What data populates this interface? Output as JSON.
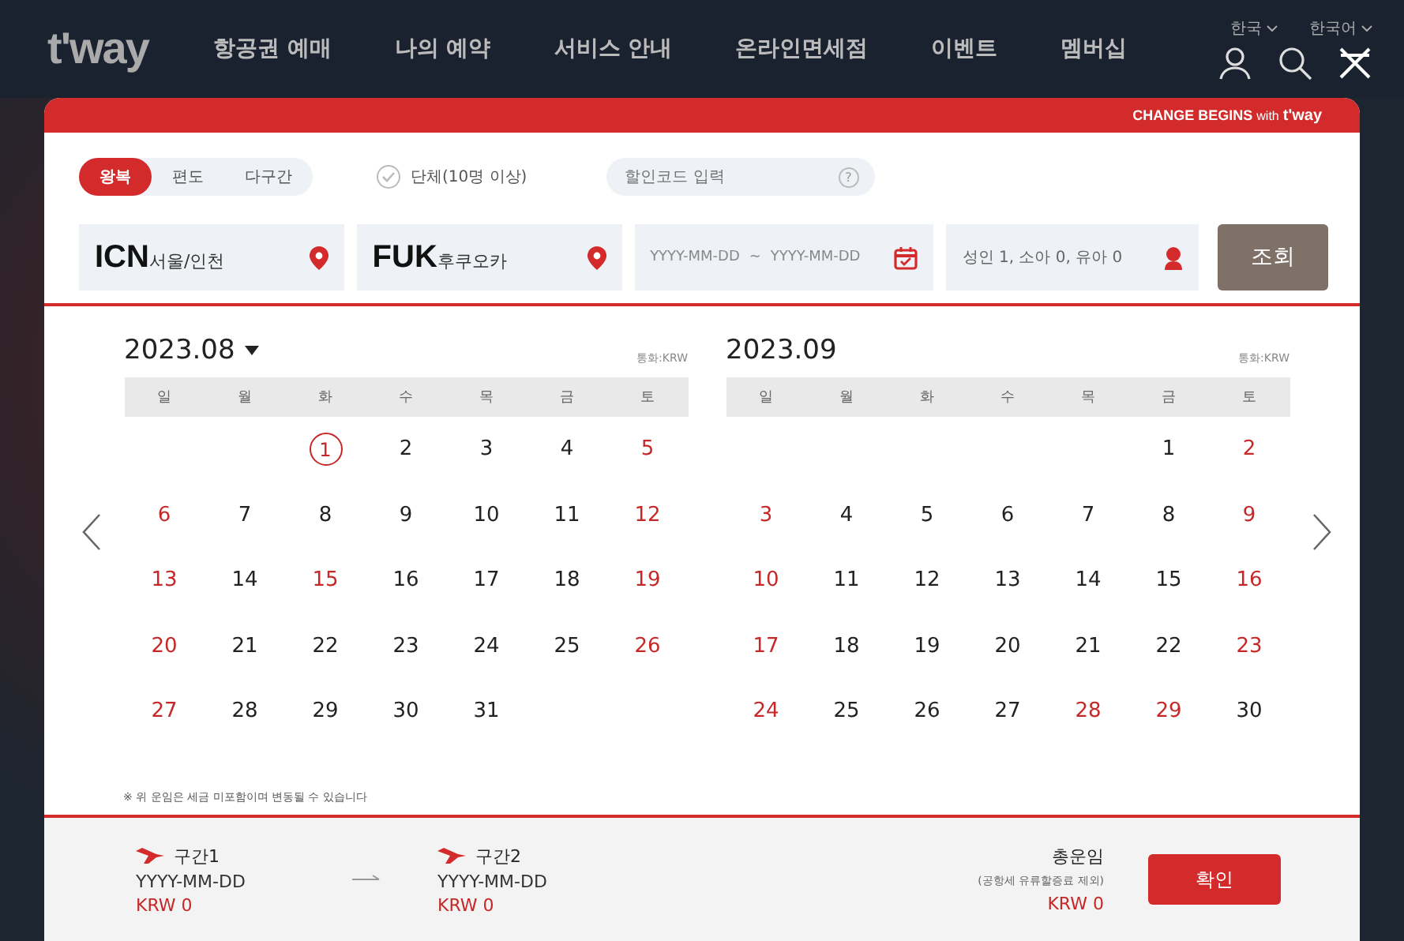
{
  "header": {
    "logo": "t'way",
    "nav": [
      "항공권 예매",
      "나의 예약",
      "서비스 안내",
      "온라인면세점",
      "이벤트",
      "멤버십"
    ],
    "country": "한국",
    "language": "한국어"
  },
  "banner": {
    "slogan": "CHANGE BEGINS",
    "with": "with",
    "brand": "t'way"
  },
  "trip_types": [
    {
      "label": "왕복",
      "selected": true
    },
    {
      "label": "편도",
      "selected": false
    },
    {
      "label": "다구간",
      "selected": false
    }
  ],
  "group": {
    "label": "단체(10명 이상)",
    "checked": false
  },
  "promo": {
    "placeholder": "할인코드 입력",
    "help": "?"
  },
  "origin": {
    "code": "ICN",
    "city": "서울/인천"
  },
  "destination": {
    "code": "FUK",
    "city": "후쿠오카"
  },
  "dates": {
    "from_placeholder": "YYYY-MM-DD",
    "separator": "~",
    "to_placeholder": "YYYY-MM-DD"
  },
  "passengers": {
    "value": "성인 1, 소아 0, 유아 0"
  },
  "search_button": "조회",
  "months": [
    {
      "title": "2023.08",
      "dropdown": true,
      "currency": "통화:KRW",
      "weekdays": [
        "일",
        "월",
        "화",
        "수",
        "목",
        "금",
        "토"
      ],
      "weeks": [
        [
          {
            "kind": "blank"
          },
          {
            "kind": "blank"
          },
          {
            "kind": "date",
            "day": "1",
            "holiday": false,
            "circled": true
          },
          {
            "kind": "date",
            "day": "2",
            "holiday": false,
            "circled": false
          },
          {
            "kind": "date",
            "day": "3",
            "holiday": false,
            "circled": false
          },
          {
            "kind": "date",
            "day": "4",
            "holiday": false,
            "circled": false
          },
          {
            "kind": "date",
            "day": "5",
            "holiday": true,
            "circled": false
          }
        ],
        [
          {
            "kind": "date",
            "day": "6",
            "holiday": true,
            "circled": false
          },
          {
            "kind": "date",
            "day": "7",
            "holiday": false,
            "circled": false
          },
          {
            "kind": "date",
            "day": "8",
            "holiday": false,
            "circled": false
          },
          {
            "kind": "date",
            "day": "9",
            "holiday": false,
            "circled": false
          },
          {
            "kind": "date",
            "day": "10",
            "holiday": false,
            "circled": false
          },
          {
            "kind": "date",
            "day": "11",
            "holiday": false,
            "circled": false
          },
          {
            "kind": "date",
            "day": "12",
            "holiday": true,
            "circled": false
          }
        ],
        [
          {
            "kind": "date",
            "day": "13",
            "holiday": true,
            "circled": false
          },
          {
            "kind": "date",
            "day": "14",
            "holiday": false,
            "circled": false
          },
          {
            "kind": "date",
            "day": "15",
            "holiday": true,
            "circled": false
          },
          {
            "kind": "date",
            "day": "16",
            "holiday": false,
            "circled": false
          },
          {
            "kind": "date",
            "day": "17",
            "holiday": false,
            "circled": false
          },
          {
            "kind": "date",
            "day": "18",
            "holiday": false,
            "circled": false
          },
          {
            "kind": "date",
            "day": "19",
            "holiday": true,
            "circled": false
          }
        ],
        [
          {
            "kind": "date",
            "day": "20",
            "holiday": true,
            "circled": false
          },
          {
            "kind": "date",
            "day": "21",
            "holiday": false,
            "circled": false
          },
          {
            "kind": "date",
            "day": "22",
            "holiday": false,
            "circled": false
          },
          {
            "kind": "date",
            "day": "23",
            "holiday": false,
            "circled": false
          },
          {
            "kind": "date",
            "day": "24",
            "holiday": false,
            "circled": false
          },
          {
            "kind": "date",
            "day": "25",
            "holiday": false,
            "circled": false
          },
          {
            "kind": "date",
            "day": "26",
            "holiday": true,
            "circled": false
          }
        ],
        [
          {
            "kind": "date",
            "day": "27",
            "holiday": true,
            "circled": false
          },
          {
            "kind": "date",
            "day": "28",
            "holiday": false,
            "circled": false
          },
          {
            "kind": "date",
            "day": "29",
            "holiday": false,
            "circled": false
          },
          {
            "kind": "date",
            "day": "30",
            "holiday": false,
            "circled": false
          },
          {
            "kind": "date",
            "day": "31",
            "holiday": false,
            "circled": false
          },
          {
            "kind": "blank"
          },
          {
            "kind": "blank"
          }
        ]
      ]
    },
    {
      "title": "2023.09",
      "dropdown": false,
      "currency": "통화:KRW",
      "weekdays": [
        "일",
        "월",
        "화",
        "수",
        "목",
        "금",
        "토"
      ],
      "weeks": [
        [
          {
            "kind": "blank"
          },
          {
            "kind": "blank"
          },
          {
            "kind": "blank"
          },
          {
            "kind": "blank"
          },
          {
            "kind": "blank"
          },
          {
            "kind": "date",
            "day": "1",
            "holiday": false,
            "circled": false
          },
          {
            "kind": "date",
            "day": "2",
            "holiday": true,
            "circled": false
          }
        ],
        [
          {
            "kind": "date",
            "day": "3",
            "holiday": true,
            "circled": false
          },
          {
            "kind": "date",
            "day": "4",
            "holiday": false,
            "circled": false
          },
          {
            "kind": "date",
            "day": "5",
            "holiday": false,
            "circled": false
          },
          {
            "kind": "date",
            "day": "6",
            "holiday": false,
            "circled": false
          },
          {
            "kind": "date",
            "day": "7",
            "holiday": false,
            "circled": false
          },
          {
            "kind": "date",
            "day": "8",
            "holiday": false,
            "circled": false
          },
          {
            "kind": "date",
            "day": "9",
            "holiday": true,
            "circled": false
          }
        ],
        [
          {
            "kind": "date",
            "day": "10",
            "holiday": true,
            "circled": false
          },
          {
            "kind": "date",
            "day": "11",
            "holiday": false,
            "circled": false
          },
          {
            "kind": "date",
            "day": "12",
            "holiday": false,
            "circled": false
          },
          {
            "kind": "date",
            "day": "13",
            "holiday": false,
            "circled": false
          },
          {
            "kind": "date",
            "day": "14",
            "holiday": false,
            "circled": false
          },
          {
            "kind": "date",
            "day": "15",
            "holiday": false,
            "circled": false
          },
          {
            "kind": "date",
            "day": "16",
            "holiday": true,
            "circled": false
          }
        ],
        [
          {
            "kind": "date",
            "day": "17",
            "holiday": true,
            "circled": false
          },
          {
            "kind": "date",
            "day": "18",
            "holiday": false,
            "circled": false
          },
          {
            "kind": "date",
            "day": "19",
            "holiday": false,
            "circled": false
          },
          {
            "kind": "date",
            "day": "20",
            "holiday": false,
            "circled": false
          },
          {
            "kind": "date",
            "day": "21",
            "holiday": false,
            "circled": false
          },
          {
            "kind": "date",
            "day": "22",
            "holiday": false,
            "circled": false
          },
          {
            "kind": "date",
            "day": "23",
            "holiday": true,
            "circled": false
          }
        ],
        [
          {
            "kind": "date",
            "day": "24",
            "holiday": true,
            "circled": false
          },
          {
            "kind": "date",
            "day": "25",
            "holiday": false,
            "circled": false
          },
          {
            "kind": "date",
            "day": "26",
            "holiday": false,
            "circled": false
          },
          {
            "kind": "date",
            "day": "27",
            "holiday": false,
            "circled": false
          },
          {
            "kind": "date",
            "day": "28",
            "holiday": true,
            "circled": false
          },
          {
            "kind": "date",
            "day": "29",
            "holiday": true,
            "circled": false
          },
          {
            "kind": "date",
            "day": "30",
            "holiday": false,
            "circled": false
          }
        ]
      ]
    }
  ],
  "notice": "※ 위 운임은 세금 미포함이며 변동될 수 있습니다",
  "segments": [
    {
      "label": "구간1",
      "date": "YYYY-MM-DD",
      "fare": "KRW 0"
    },
    {
      "label": "구간2",
      "date": "YYYY-MM-DD",
      "fare": "KRW 0"
    }
  ],
  "total": {
    "label": "총운임",
    "note": "(공항세 유류할증료 제외)",
    "fare": "KRW 0"
  },
  "confirm_button": "확인"
}
